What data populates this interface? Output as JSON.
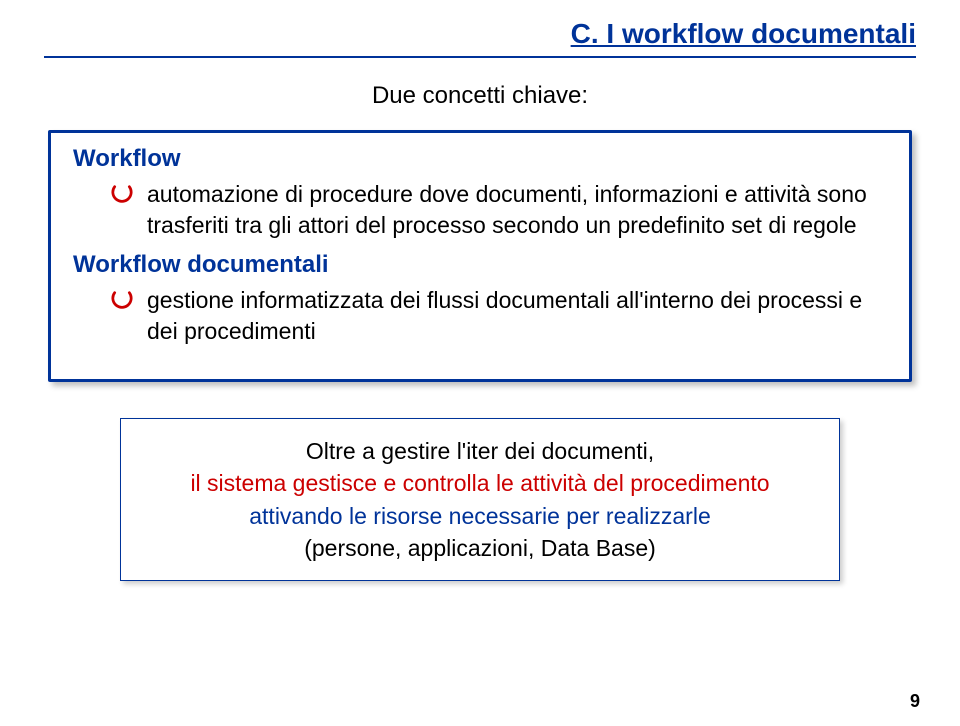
{
  "header": {
    "title": "C. I workflow documentali"
  },
  "subtitle": "Due concetti chiave:",
  "outerBox": {
    "section1": {
      "label": "Workflow",
      "text": "automazione di procedure dove documenti, informazioni e attività sono  trasferiti tra gli attori del processo secondo un predefinito set di regole"
    },
    "section2": {
      "label": "Workflow documentali",
      "text": "gestione informatizzata dei flussi documentali all'interno dei processi e dei procedimenti"
    }
  },
  "innerBox": {
    "line1": "Oltre a gestire l'iter dei documenti,",
    "line2": "il sistema gestisce e controlla le attività del procedimento",
    "line3": "attivando le risorse necessarie per realizzarle",
    "line4": "(persone, applicazioni, Data Base)"
  },
  "pageNumber": "9"
}
